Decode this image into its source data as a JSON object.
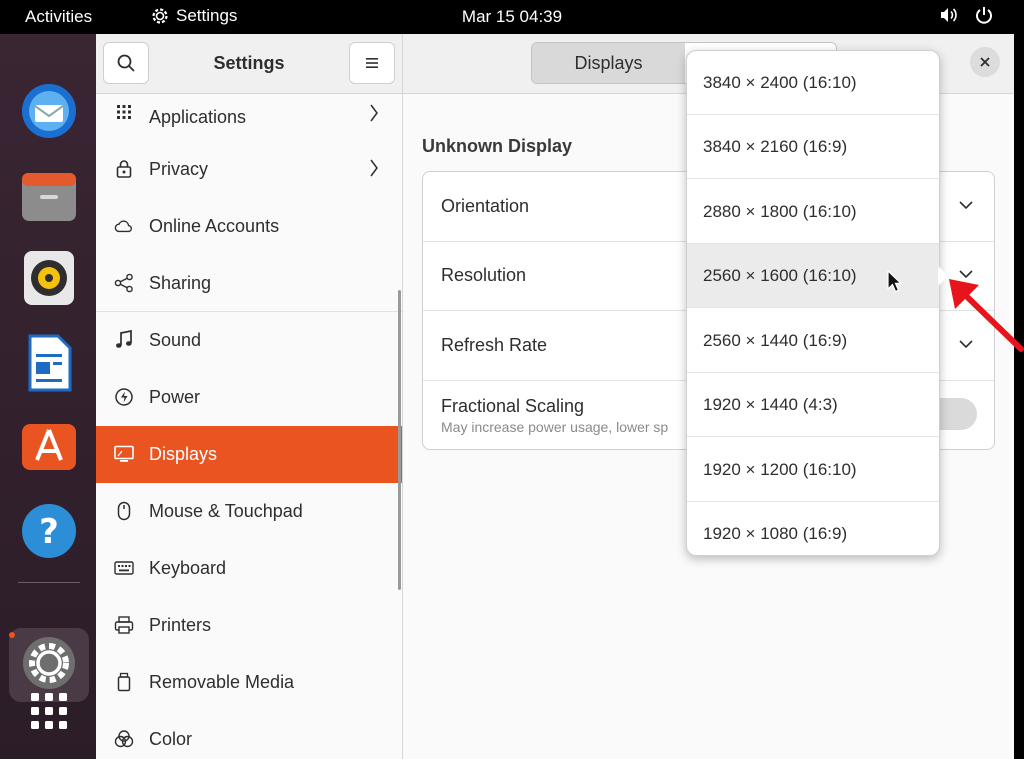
{
  "topbar": {
    "activities": "Activities",
    "app_name": "Settings",
    "clock": "Mar 15  04:39",
    "icons": [
      "settings-gear-icon",
      "volume-icon",
      "power-icon"
    ]
  },
  "dock": {
    "apps": [
      "thunderbird-icon",
      "files-icon",
      "rhythmbox-icon",
      "writer-icon",
      "app-center-icon",
      "help-icon",
      "settings-icon",
      "app-grid-icon"
    ],
    "accent": "#e95420"
  },
  "sidebar": {
    "title": "Settings",
    "search_icon": "search-icon",
    "menu_icon": "hamburger-icon",
    "items": [
      {
        "label": "Applications",
        "icon": "grid-icon",
        "chevron": true
      },
      {
        "label": "Privacy",
        "icon": "lock-icon",
        "chevron": true
      },
      {
        "label": "Online Accounts",
        "icon": "cloud-icon",
        "chevron": false
      },
      {
        "label": "Sharing",
        "icon": "share-icon",
        "chevron": false
      },
      {
        "label": "Sound",
        "icon": "music-note-icon",
        "chevron": false
      },
      {
        "label": "Power",
        "icon": "power-icon",
        "chevron": false
      },
      {
        "label": "Displays",
        "icon": "display-icon",
        "chevron": false,
        "active": true
      },
      {
        "label": "Mouse & Touchpad",
        "icon": "mouse-icon",
        "chevron": false
      },
      {
        "label": "Keyboard",
        "icon": "keyboard-icon",
        "chevron": false
      },
      {
        "label": "Printers",
        "icon": "printer-icon",
        "chevron": false
      },
      {
        "label": "Removable Media",
        "icon": "removable-media-icon",
        "chevron": false
      },
      {
        "label": "Color",
        "icon": "color-icon",
        "chevron": false
      }
    ]
  },
  "main": {
    "tab_displays": "Displays",
    "display_name": "Unknown Display",
    "rows": [
      {
        "label": "Orientation"
      },
      {
        "label": "Resolution"
      },
      {
        "label": "Refresh Rate"
      },
      {
        "label": "Fractional Scaling",
        "sublabel": "May increase power usage, lower sp"
      }
    ]
  },
  "resolution_popover": {
    "options": [
      "3840 × 2400 (16:10)",
      "3840 × 2160 (16:9)",
      "2880 × 1800 (16:10)",
      "2560 × 1600 (16:10)",
      "2560 × 1440 (16:9)",
      "1920 × 1440 (4:3)",
      "1920 × 1200 (16:10)",
      "1920 × 1080 (16:9)"
    ],
    "hovered": "2560 × 1600 (16:10)"
  },
  "colors": {
    "accent": "#e95420",
    "annotation_arrow": "#e8141b"
  }
}
